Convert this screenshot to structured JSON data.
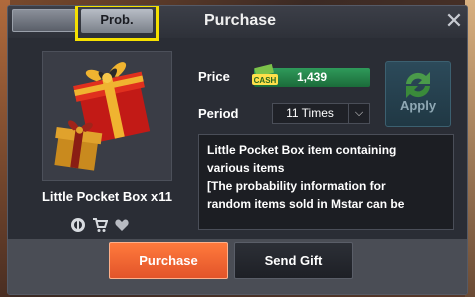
{
  "tabs": {
    "blank_label": "",
    "prob_label": "Prob."
  },
  "dialog": {
    "title": "Purchase",
    "close_glyph": "✕"
  },
  "item": {
    "name": "Little Pocket Box x11",
    "icons": [
      "gift-shop-icon",
      "cart-icon",
      "heart-icon"
    ]
  },
  "price": {
    "label": "Price",
    "currency_icon": "cash-icon",
    "currency_text": "CASH",
    "value": "1,439"
  },
  "period": {
    "label": "Period",
    "selected": "11 Times",
    "chevron": "⌵"
  },
  "apply": {
    "label": "Apply"
  },
  "description": {
    "lines": [
      "Little Pocket Box item containing",
      "various items",
      "[The probability information for",
      "random items sold in Mstar can be"
    ]
  },
  "footer": {
    "purchase_label": "Purchase",
    "send_gift_label": "Send Gift"
  },
  "colors": {
    "highlight_frame": "#f5e000",
    "price_bar": "#2f9a5a",
    "purchase_button": "#f0643a",
    "dialog_bg": "#2a2d35"
  }
}
